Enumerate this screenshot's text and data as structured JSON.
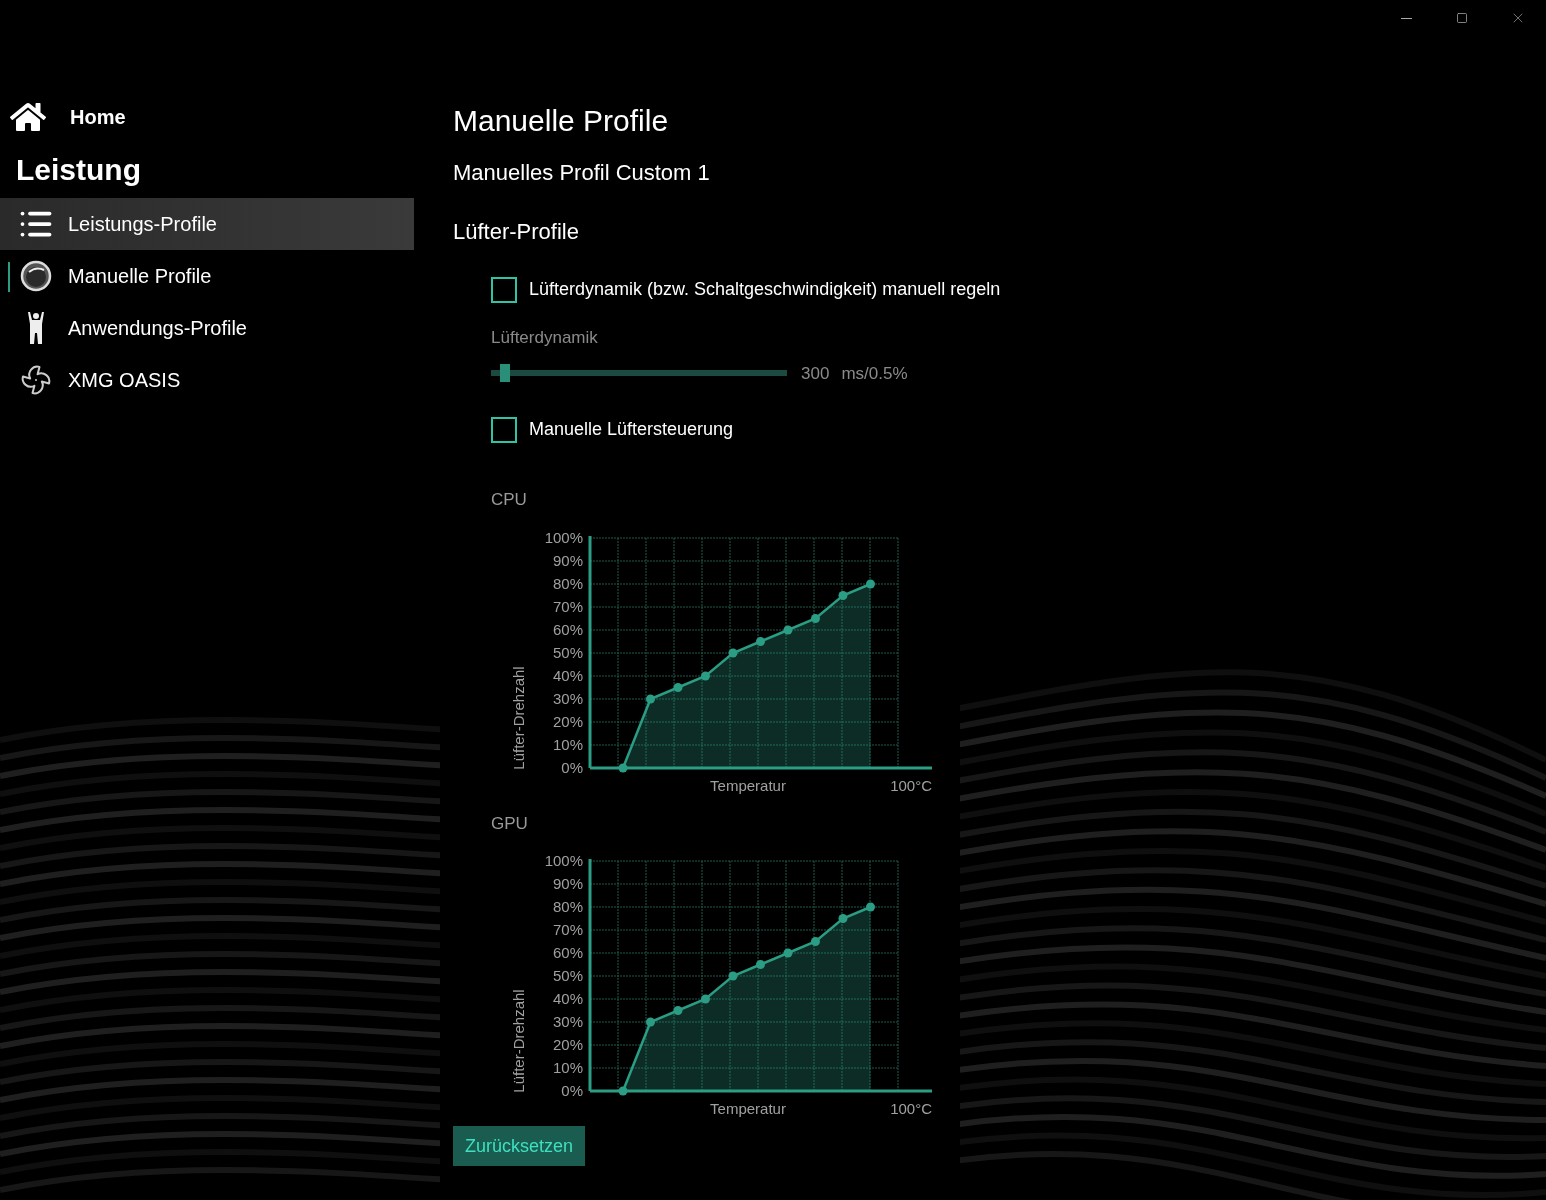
{
  "sidebar": {
    "home": "Home",
    "section": "Leistung",
    "items": [
      {
        "label": "Leistungs-Profile",
        "selected": true,
        "current": false
      },
      {
        "label": "Manuelle Profile",
        "selected": false,
        "current": true
      },
      {
        "label": "Anwendungs-Profile",
        "selected": false,
        "current": false
      },
      {
        "label": "XMG OASIS",
        "selected": false,
        "current": false
      }
    ]
  },
  "main": {
    "title": "Manuelle Profile",
    "profile": "Manuelles Profil Custom 1",
    "section": "Lüfter-Profile",
    "dynamics_checkbox": {
      "label": "Lüfterdynamik (bzw. Schaltgeschwindigkeit) manuell regeln",
      "checked": false
    },
    "slider": {
      "label": "Lüfterdynamik",
      "level": 0.03,
      "reading": "300",
      "unit": "ms/0.5%"
    },
    "manual_checkbox": {
      "label": "Manuelle Lüftersteuerung",
      "checked": false
    },
    "charts": [
      {
        "label": "CPU",
        "x_end_label": "100°C",
        "chart_data": {
          "type": "area",
          "xlabel": "Temperatur",
          "ylabel": "Lüfter-Drehzahl",
          "grid": true,
          "values": [
            0,
            30,
            35,
            40,
            50,
            55,
            60,
            65,
            75,
            80
          ],
          "ylim": [
            0,
            100
          ],
          "yticks": [
            {
              "value": 0,
              "label": "0%"
            },
            {
              "value": 10,
              "label": "10%"
            },
            {
              "value": 20,
              "label": "20%"
            },
            {
              "value": 30,
              "label": "30%"
            },
            {
              "value": 40,
              "label": "40%"
            },
            {
              "value": 50,
              "label": "50%"
            },
            {
              "value": 60,
              "label": "60%"
            },
            {
              "value": 70,
              "label": "70%"
            },
            {
              "value": 80,
              "label": "80%"
            },
            {
              "value": 90,
              "label": "90%"
            },
            {
              "value": 100,
              "label": "100%"
            }
          ]
        }
      },
      {
        "label": "GPU",
        "x_end_label": "100°C",
        "chart_data": {
          "type": "area",
          "xlabel": "Temperatur",
          "ylabel": "Lüfter-Drehzahl",
          "grid": true,
          "values": [
            0,
            30,
            35,
            40,
            50,
            55,
            60,
            65,
            75,
            80
          ],
          "ylim": [
            0,
            100
          ],
          "yticks": [
            {
              "value": 0,
              "label": "0%"
            },
            {
              "value": 10,
              "label": "10%"
            },
            {
              "value": 20,
              "label": "20%"
            },
            {
              "value": 30,
              "label": "30%"
            },
            {
              "value": 40,
              "label": "40%"
            },
            {
              "value": 50,
              "label": "50%"
            },
            {
              "value": 60,
              "label": "60%"
            },
            {
              "value": 70,
              "label": "70%"
            },
            {
              "value": 80,
              "label": "80%"
            },
            {
              "value": 90,
              "label": "90%"
            },
            {
              "value": 100,
              "label": "100%"
            }
          ]
        }
      }
    ],
    "reset_button": "Zurücksetzen"
  }
}
